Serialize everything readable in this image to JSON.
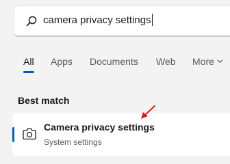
{
  "search": {
    "query": "camera privacy settings",
    "icon": "search-icon"
  },
  "tabs": [
    {
      "label": "All",
      "active": true
    },
    {
      "label": "Apps"
    },
    {
      "label": "Documents"
    },
    {
      "label": "Web"
    },
    {
      "label": "More"
    }
  ],
  "section": {
    "label": "Best match"
  },
  "best_match": {
    "title": "Camera privacy settings",
    "subtitle": "System settings",
    "icon": "camera-icon"
  },
  "colors": {
    "accent": "#005fb8",
    "annotation_arrow": "#e01b1b"
  }
}
